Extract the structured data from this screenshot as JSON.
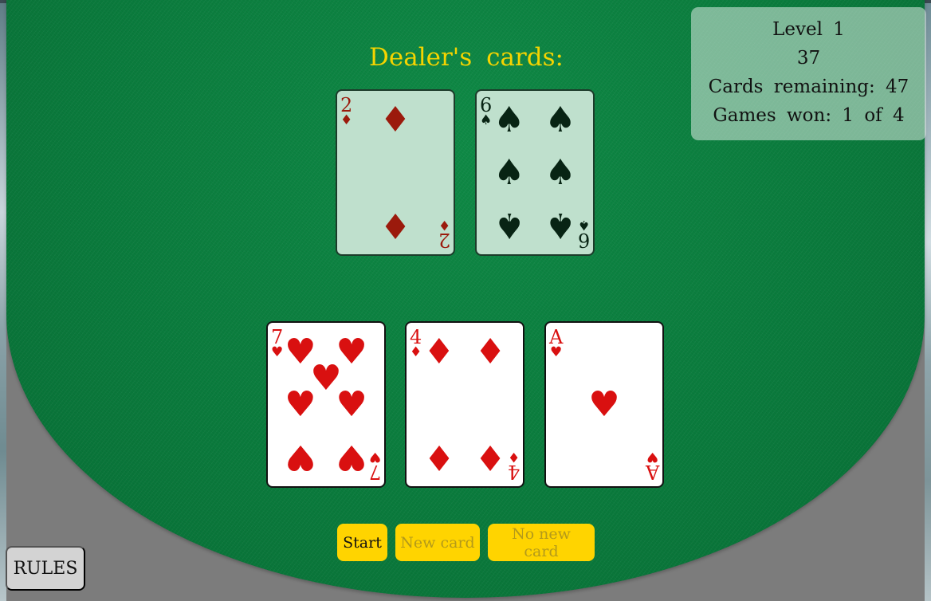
{
  "info": {
    "level": "Level 1",
    "score": "37",
    "cards_remaining": "Cards remaining: 47",
    "games_won": "Games won: 1 of 4"
  },
  "dealer": {
    "title": "Dealer's cards:",
    "cards": [
      {
        "rank": "2",
        "suit": "diamonds",
        "symbol": "♦",
        "color": "red"
      },
      {
        "rank": "6",
        "suit": "spades",
        "symbol": "♠",
        "color": "black"
      }
    ]
  },
  "player": {
    "cards": [
      {
        "rank": "7",
        "suit": "hearts",
        "symbol": "♥",
        "color": "red"
      },
      {
        "rank": "4",
        "suit": "diamonds",
        "symbol": "♦",
        "color": "red"
      },
      {
        "rank": "A",
        "suit": "hearts",
        "symbol": "♥",
        "color": "red"
      }
    ]
  },
  "buttons": {
    "start": "Start",
    "new_card": "New card",
    "no_new_card": "No new card"
  },
  "rules_label": "RULES",
  "colors": {
    "felt": "#0c8040",
    "title": "#f5d400",
    "button": "#ffd400",
    "red_suit": "#d91010"
  }
}
